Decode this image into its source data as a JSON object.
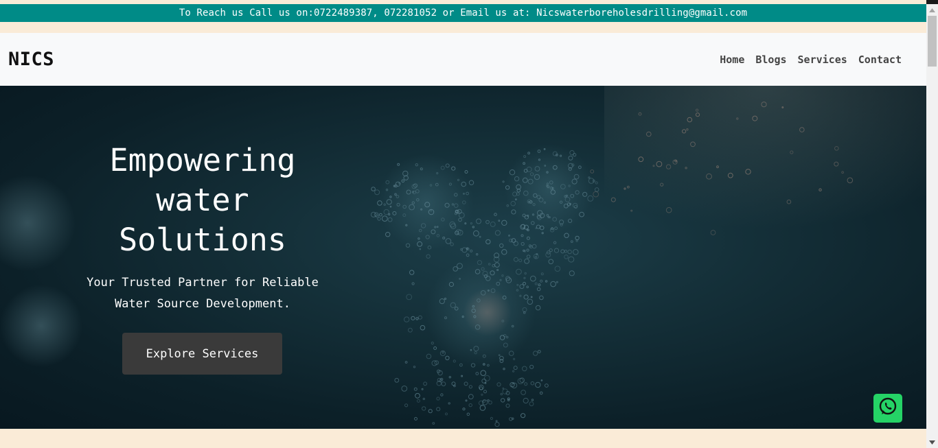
{
  "contact_bar": {
    "text": "To Reach us Call us on:0722489387, 072281052 or Email us at: Nicswaterboreholesdrilling@gmail.com"
  },
  "navbar": {
    "brand": "NICS",
    "links": [
      "Home",
      "Blogs",
      "Services",
      "Contact"
    ]
  },
  "hero": {
    "title_lines": [
      "Empowering",
      "water",
      "Solutions"
    ],
    "subtitle_lines": [
      "Your Trusted Partner for Reliable",
      "Water Source Development."
    ],
    "cta_label": "Explore Services"
  },
  "floating": {
    "whatsapp_icon": "whatsapp-icon",
    "whatsapp_color": "#25d366"
  },
  "colors": {
    "topbar": "#008b87",
    "page_bg": "#faebd7",
    "navbar_bg": "#f8f9fa",
    "cta_bg": "#3a3a3a"
  }
}
